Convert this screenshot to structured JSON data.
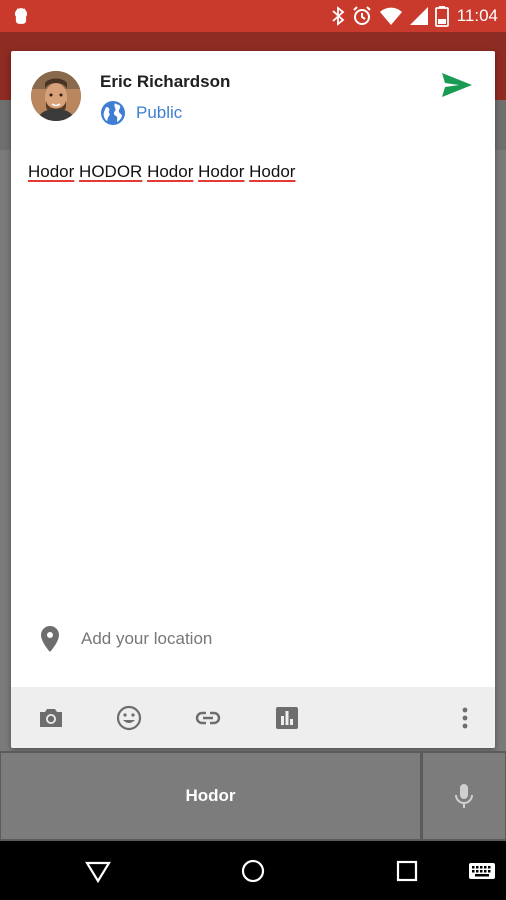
{
  "status_bar": {
    "time": "11:04",
    "icons": [
      "android-debug-icon",
      "bluetooth-icon",
      "alarm-icon",
      "wifi-icon",
      "signal-icon",
      "battery-icon"
    ],
    "color": "#c93a2c"
  },
  "composer": {
    "author_name": "Eric Richardson",
    "audience_label": "Public",
    "post_text_words": [
      "Hodor",
      "HODOR",
      "Hodor",
      "Hodor",
      "Hodor"
    ],
    "location_placeholder": "Add your location",
    "toolbar_icons": [
      "camera-icon",
      "emoji-icon",
      "link-icon",
      "poll-icon",
      "more-vert-icon"
    ],
    "accent_color": "#3e7fd3",
    "send_color": "#1a9b54"
  },
  "keyboard": {
    "suggestion": "Hodor",
    "mic_icon": "mic-icon"
  },
  "nav_bar": {
    "buttons": [
      "back-icon",
      "home-icon",
      "recents-icon",
      "keyboard-icon"
    ]
  }
}
